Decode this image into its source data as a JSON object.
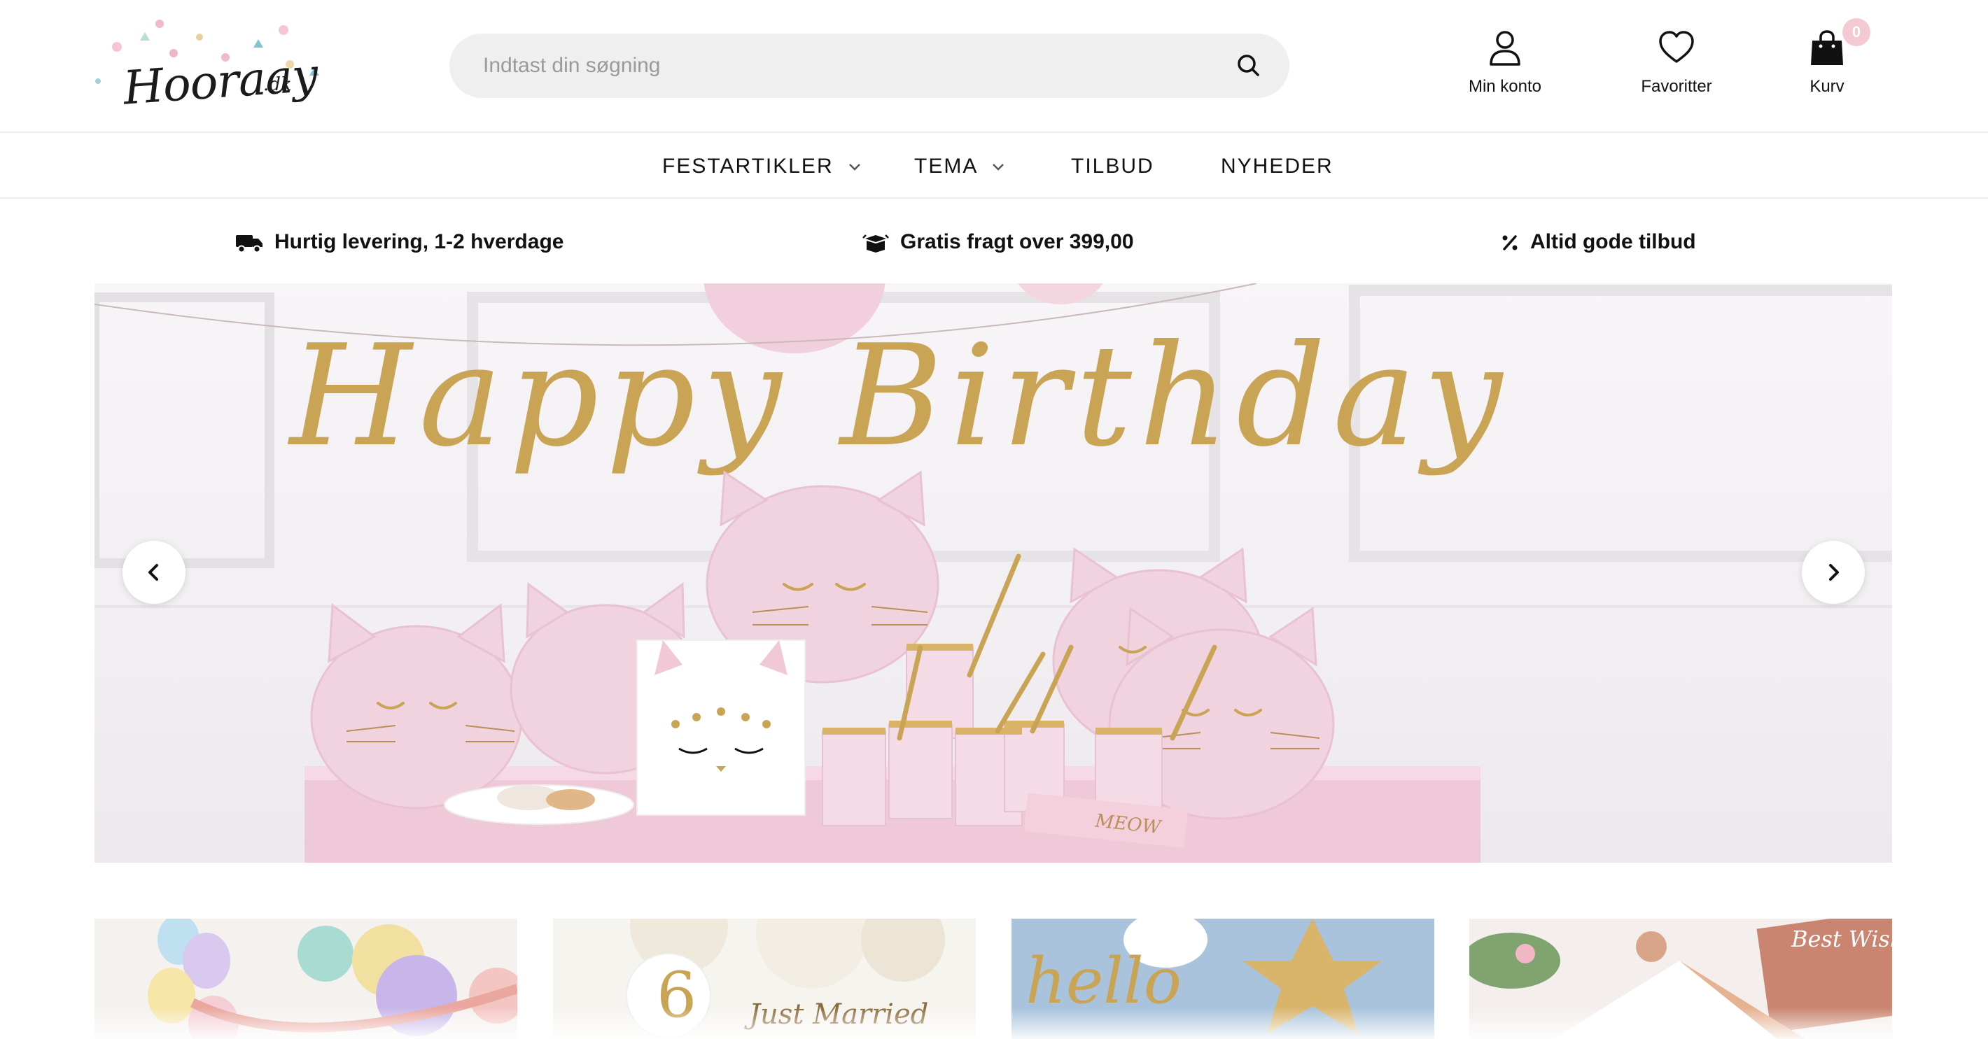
{
  "brand": {
    "logo_text": "Hooraay",
    "logo_suffix": ".dk"
  },
  "search": {
    "placeholder": "Indtast din søgning",
    "value": "",
    "icon": "search-icon"
  },
  "header_actions": {
    "account": {
      "label": "Min konto",
      "icon": "user-icon"
    },
    "favorites": {
      "label": "Favoritter",
      "icon": "heart-icon"
    },
    "cart": {
      "label": "Kurv",
      "icon": "shopping-bag-icon",
      "count": "0"
    }
  },
  "nav": {
    "items": [
      {
        "label": "FESTARTIKLER",
        "has_dropdown": true
      },
      {
        "label": "TEMA",
        "has_dropdown": true
      },
      {
        "label": "TILBUD",
        "has_dropdown": false
      },
      {
        "label": "NYHEDER",
        "has_dropdown": false
      }
    ]
  },
  "usp": [
    {
      "text": "Hurtig levering, 1-2 hverdage",
      "icon": "truck-icon"
    },
    {
      "text": "Gratis fragt over 399,00",
      "icon": "box-icon"
    },
    {
      "text": "Altid gode tilbud",
      "icon": "percent-icon"
    }
  ],
  "hero": {
    "banner_text": "Happy Birthday",
    "napkin_text": "MEOW",
    "prev_icon": "chevron-left-icon",
    "next_icon": "chevron-right-icon"
  },
  "tiles": [
    {
      "name": "balloons-pastel"
    },
    {
      "name": "birthday-gold",
      "number": "6",
      "script": "Just Married"
    },
    {
      "name": "blue-star",
      "script": "hello"
    },
    {
      "name": "rose-gold",
      "script": "Best Wishes"
    }
  ],
  "colors": {
    "badge": "#f3c9d2",
    "search_bg": "#efefef",
    "gold": "#c9a455",
    "pink": "#f1d3df"
  }
}
